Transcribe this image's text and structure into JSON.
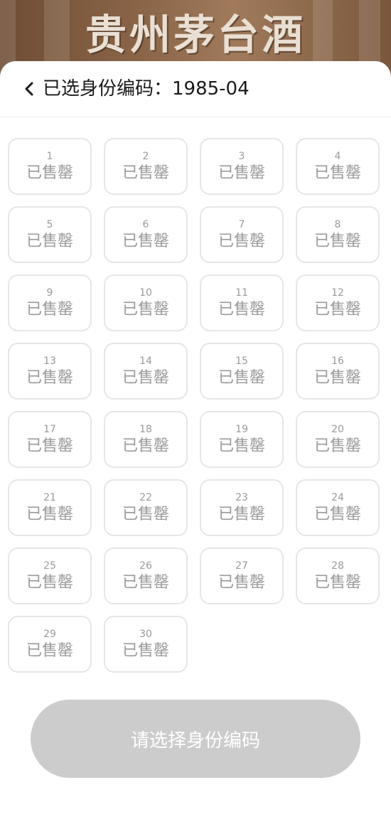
{
  "banner": {
    "brand_text": "贵州茅台酒",
    "bg_color": "#8a6447"
  },
  "header": {
    "back_icon": "chevron-left-icon",
    "title": "已选身份编码：1985-04"
  },
  "codes": [
    {
      "number": "1",
      "status": "已售罄"
    },
    {
      "number": "2",
      "status": "已售罄"
    },
    {
      "number": "3",
      "status": "已售罄"
    },
    {
      "number": "4",
      "status": "已售罄"
    },
    {
      "number": "5",
      "status": "已售罄"
    },
    {
      "number": "6",
      "status": "已售罄"
    },
    {
      "number": "7",
      "status": "已售罄"
    },
    {
      "number": "8",
      "status": "已售罄"
    },
    {
      "number": "9",
      "status": "已售罄"
    },
    {
      "number": "10",
      "status": "已售罄"
    },
    {
      "number": "11",
      "status": "已售罄"
    },
    {
      "number": "12",
      "status": "已售罄"
    },
    {
      "number": "13",
      "status": "已售罄"
    },
    {
      "number": "14",
      "status": "已售罄"
    },
    {
      "number": "15",
      "status": "已售罄"
    },
    {
      "number": "16",
      "status": "已售罄"
    },
    {
      "number": "17",
      "status": "已售罄"
    },
    {
      "number": "18",
      "status": "已售罄"
    },
    {
      "number": "19",
      "status": "已售罄"
    },
    {
      "number": "20",
      "status": "已售罄"
    },
    {
      "number": "21",
      "status": "已售罄"
    },
    {
      "number": "22",
      "status": "已售罄"
    },
    {
      "number": "23",
      "status": "已售罄"
    },
    {
      "number": "24",
      "status": "已售罄"
    },
    {
      "number": "25",
      "status": "已售罄"
    },
    {
      "number": "26",
      "status": "已售罄"
    },
    {
      "number": "27",
      "status": "已售罄"
    },
    {
      "number": "28",
      "status": "已售罄"
    },
    {
      "number": "29",
      "status": "已售罄"
    },
    {
      "number": "30",
      "status": "已售罄"
    }
  ],
  "footer": {
    "confirm_label": "请选择身份编码",
    "confirm_color": "#cccccc"
  }
}
